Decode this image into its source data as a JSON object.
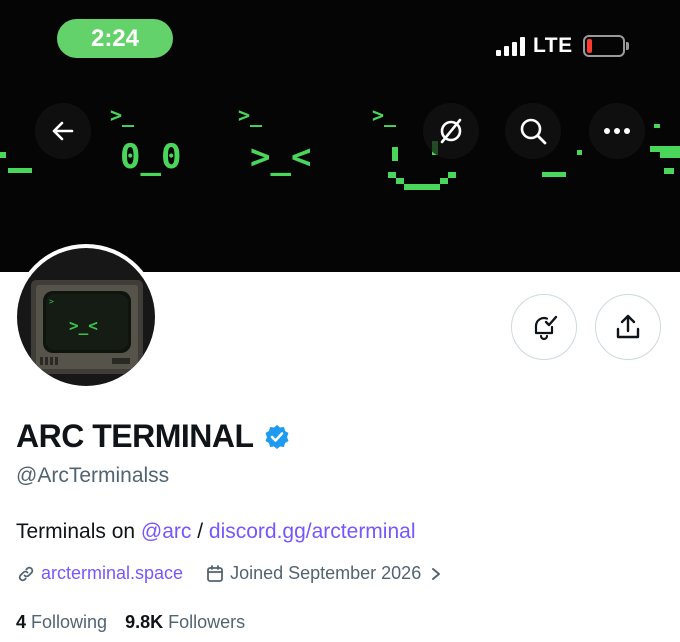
{
  "status_bar": {
    "time": "2:24",
    "network": "LTE",
    "battery_level": 0.12
  },
  "header": {
    "buttons": [
      "back",
      "nft-off",
      "search",
      "more"
    ]
  },
  "banner": {
    "prompts": [
      ">_",
      ">_",
      ">_"
    ],
    "faces": [
      "0_0",
      ">_<"
    ]
  },
  "profile": {
    "avatar_text": ">_<",
    "name": "ARC TERMINAL",
    "verified": true,
    "handle": "@ArcTerminalss",
    "bio": {
      "prefix": "Terminals on ",
      "mention": "@arc",
      "separator": " / ",
      "url": "discord.gg/arcterminal"
    },
    "website": "arcterminal.space",
    "joined": "Joined September 2026",
    "following_count": "4",
    "following_label": "Following",
    "followers_count": "9.8K",
    "followers_label": "Followers"
  },
  "colors": {
    "accent_link": "#7856ff",
    "verified": "#1d9bf0",
    "status_time_bg": "#63d26a",
    "terminal_green": "#3cc24a"
  }
}
